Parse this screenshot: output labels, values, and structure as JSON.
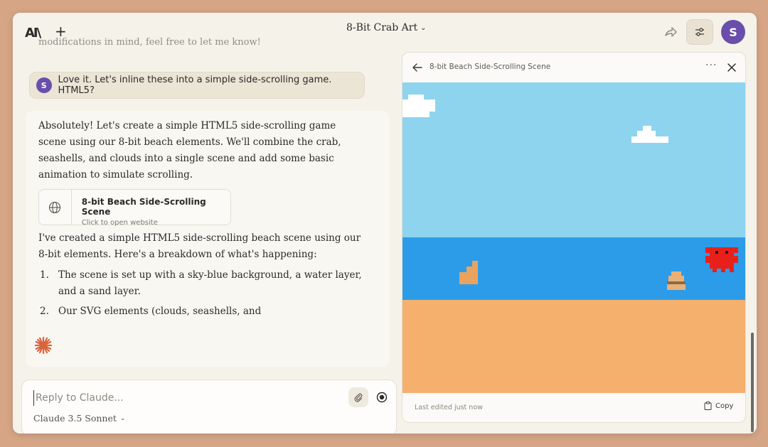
{
  "header": {
    "logo": "AI\\",
    "new_chat": "+",
    "chat_title": "8-Bit Crab Art",
    "avatar_initial": "S"
  },
  "conversation": {
    "faded_previous": "modifications in mind, feel free to let me know!",
    "user_message": {
      "initial": "S",
      "text": "Love it. Let's inline these into a simple side-scrolling game. HTML5?"
    },
    "assistant": {
      "paragraph1": "Absolutely! Let's create a simple HTML5 side-scrolling game scene using our 8-bit beach elements. We'll combine the crab, seashells, and clouds into a single scene and add some basic animation to simulate scrolling.",
      "artifact_card": {
        "title": "8-bit Beach Side-Scrolling Scene",
        "subtitle": "Click to open website"
      },
      "paragraph2": "I've created a simple HTML5 side-scrolling beach scene using our 8-bit elements. Here's a breakdown of what's happening:",
      "list": [
        {
          "num": "1.",
          "text": "The scene is set up with a sky-blue background, a water layer, and a sand layer."
        },
        {
          "num": "2.",
          "text": "Our SVG elements (clouds, seashells, and"
        }
      ]
    }
  },
  "composer": {
    "placeholder": "Reply to Claude...",
    "model": "Claude 3.5 Sonnet"
  },
  "artifact_panel": {
    "title": "8-bit Beach Side-Scrolling Scene",
    "more": "···",
    "footer_status": "Last edited just now",
    "copy_label": "Copy",
    "colors": {
      "sky": "#8ed4ef",
      "water": "#2c9ce9",
      "sand": "#f4b06c",
      "crab": "#e8201c",
      "cloud": "#ffffff",
      "shell": "#e9a35e"
    }
  }
}
